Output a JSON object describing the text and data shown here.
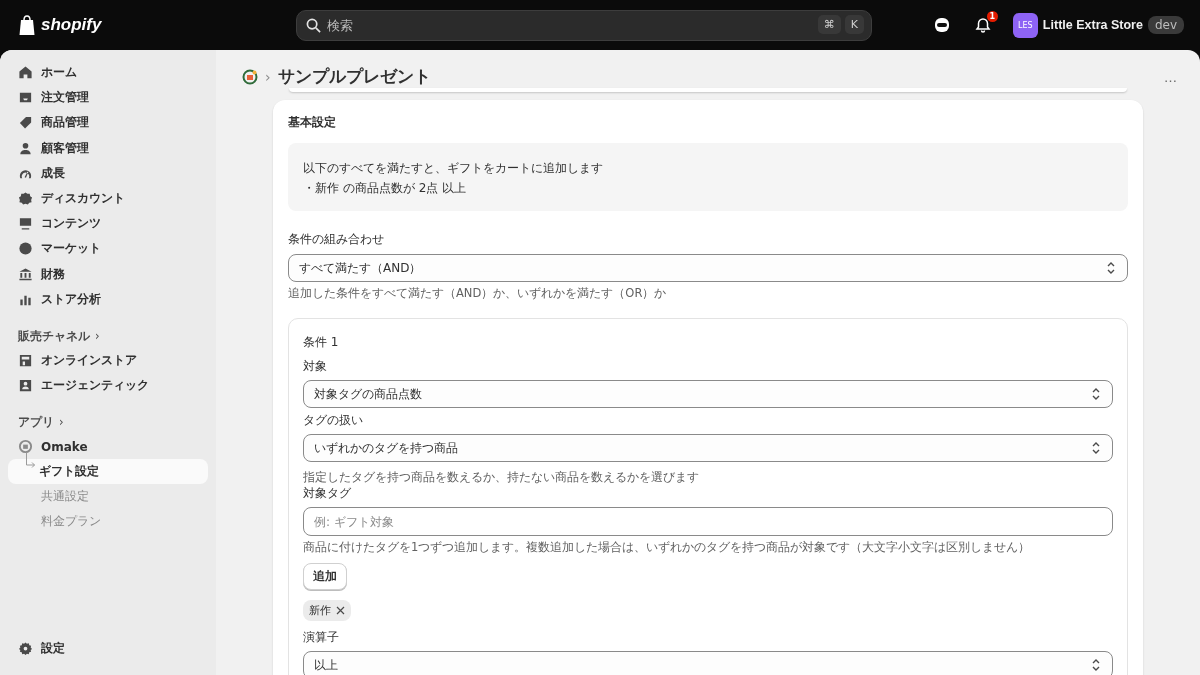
{
  "topbar": {
    "logo": "shopify",
    "search": {
      "placeholder": "検索",
      "keys": [
        "⌘",
        "K"
      ]
    },
    "notifications": "1",
    "store": {
      "avatar": "LES",
      "name": "Little Extra Store",
      "badge": "dev"
    }
  },
  "sidebar": {
    "items": [
      {
        "label": "ホーム",
        "selected": false
      },
      {
        "label": "注文管理",
        "selected": false
      },
      {
        "label": "商品管理",
        "selected": false
      },
      {
        "label": "顧客管理",
        "selected": false
      },
      {
        "label": "成長",
        "selected": false
      },
      {
        "label": "ディスカウント",
        "selected": false
      },
      {
        "label": "コンテンツ",
        "selected": false
      },
      {
        "label": "マーケット",
        "selected": false
      },
      {
        "label": "財務",
        "selected": false
      },
      {
        "label": "ストア分析",
        "selected": false
      }
    ],
    "channels": {
      "heading": "販売チャネル",
      "chevron": "›",
      "items": [
        {
          "label": "オンラインストア",
          "selected": false
        },
        {
          "label": "エージェンティック",
          "selected": false
        }
      ]
    },
    "apps": {
      "heading": "アプリ",
      "chevron": "›",
      "app": "Omake",
      "items": [
        {
          "label": "ギフト設定",
          "selected": true
        },
        {
          "label": "共通設定",
          "selected": false
        },
        {
          "label": "料金プラン",
          "selected": false
        }
      ]
    },
    "settings": "設定"
  },
  "page": {
    "separator": "›",
    "title": "サンプルプレゼント",
    "more": "…"
  },
  "card": {
    "title": "基本設定",
    "summary": [
      "以下のすべてを満たすと、ギフトをカートに追加します",
      "・新作 の商品点数が 2点 以上"
    ],
    "combination": {
      "label": "条件の組み合わせ",
      "value": "すべて満たす（AND）",
      "help": "追加した条件をすべて満たす（AND）か、いずれかを満たす（OR）か"
    },
    "condition": {
      "title": "条件 1",
      "fields": [
        {
          "kind": "select",
          "label": "対象",
          "value": "対象タグの商品点数"
        },
        {
          "kind": "select",
          "label": "タグの扱い",
          "value": "いずれかのタグを持つ商品",
          "help": "指定したタグを持つ商品を数えるか、持たない商品を数えるかを選びます"
        },
        {
          "kind": "text",
          "label": "対象タグ",
          "placeholder": "例: ギフト対象",
          "help": "商品に付けたタグを1つずつ追加します。複数追加した場合は、いずれかのタグを持つ商品が対象です（大文字小文字は区別しません）"
        },
        {
          "kind": "button",
          "label": "追加"
        },
        {
          "kind": "tags",
          "tags": [
            "新作"
          ]
        },
        {
          "kind": "select",
          "label": "演算子",
          "value": "以上"
        }
      ]
    }
  }
}
